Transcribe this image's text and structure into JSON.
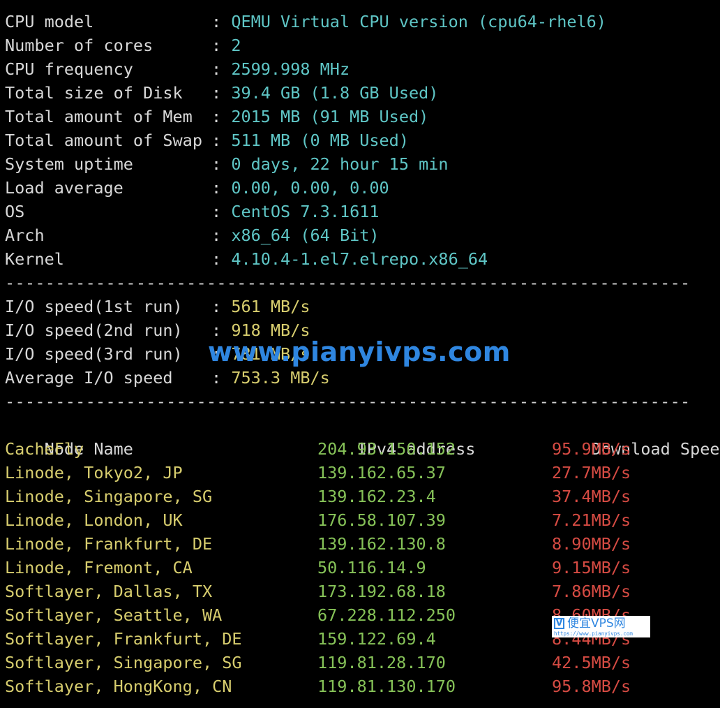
{
  "system_info": [
    {
      "label": "CPU model",
      "value": "QEMU Virtual CPU version (cpu64-rhel6)"
    },
    {
      "label": "Number of cores",
      "value": "2"
    },
    {
      "label": "CPU frequency",
      "value": "2599.998 MHz"
    },
    {
      "label": "Total size of Disk",
      "value": "39.4 GB (1.8 GB Used)"
    },
    {
      "label": "Total amount of Mem",
      "value": "2015 MB (91 MB Used)"
    },
    {
      "label": "Total amount of Swap",
      "value": "511 MB (0 MB Used)"
    },
    {
      "label": "System uptime",
      "value": "0 days, 22 hour 15 min"
    },
    {
      "label": "Load average",
      "value": "0.00, 0.00, 0.00"
    },
    {
      "label": "OS",
      "value": "CentOS 7.3.1611"
    },
    {
      "label": "Arch",
      "value": "x86_64 (64 Bit)"
    },
    {
      "label": "Kernel",
      "value": "4.10.4-1.el7.elrepo.x86_64"
    }
  ],
  "separator": ":",
  "divider": "----------------------------------------------------------------------",
  "io_speed": [
    {
      "label": "I/O speed(1st run)",
      "value": "561 MB/s"
    },
    {
      "label": "I/O speed(2nd run)",
      "value": "918 MB/s"
    },
    {
      "label": "I/O speed(3rd run)",
      "value": "781 MB/s"
    },
    {
      "label": "Average I/O speed",
      "value": "753.3 MB/s"
    }
  ],
  "speed_table": {
    "headers": [
      "Node Name",
      "IPv4 address",
      "Download Speed"
    ],
    "rows": [
      {
        "node": "CacheFly",
        "ip": "204.93.150.152",
        "speed": "95.9MB/s"
      },
      {
        "node": "Linode, Tokyo2, JP",
        "ip": "139.162.65.37",
        "speed": "27.7MB/s"
      },
      {
        "node": "Linode, Singapore, SG",
        "ip": "139.162.23.4",
        "speed": "37.4MB/s"
      },
      {
        "node": "Linode, London, UK",
        "ip": "176.58.107.39",
        "speed": "7.21MB/s"
      },
      {
        "node": "Linode, Frankfurt, DE",
        "ip": "139.162.130.8",
        "speed": "8.90MB/s"
      },
      {
        "node": "Linode, Fremont, CA",
        "ip": "50.116.14.9",
        "speed": "9.15MB/s"
      },
      {
        "node": "Softlayer, Dallas, TX",
        "ip": "173.192.68.18",
        "speed": "7.86MB/s"
      },
      {
        "node": "Softlayer, Seattle, WA",
        "ip": "67.228.112.250",
        "speed": "8.60MB/s"
      },
      {
        "node": "Softlayer, Frankfurt, DE",
        "ip": "159.122.69.4",
        "speed": "8.44MB/s"
      },
      {
        "node": "Softlayer, Singapore, SG",
        "ip": "119.81.28.170",
        "speed": "42.5MB/s"
      },
      {
        "node": "Softlayer, HongKong, CN",
        "ip": "119.81.130.170",
        "speed": "95.8MB/s"
      }
    ]
  },
  "watermark": {
    "main_text": "www.pianyivps.com",
    "badge_logo": "V",
    "badge_cn": "便宜VPS网",
    "badge_url": "https://www.pianyivps.com"
  },
  "colors": {
    "background": "#000000",
    "label": "#d8d8d8",
    "sysinfo_value": "#5fc6c6",
    "io_value": "#d7cd6e",
    "node_name": "#d7cd6e",
    "ip": "#86c258",
    "speed": "#d64b43",
    "watermark": "#2f86e0"
  }
}
